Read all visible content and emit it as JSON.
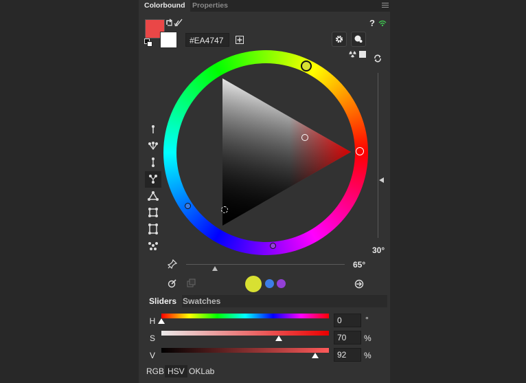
{
  "tabs": [
    {
      "label": "Colorbound",
      "active": true
    },
    {
      "label": "Properties",
      "active": false
    }
  ],
  "header": {
    "help_label": "?",
    "foreground_color": "#EA4747",
    "background_color": "#FFFFFF",
    "hex_value": "#EA4747",
    "add_label": "+"
  },
  "wheel": {
    "rotation_label": "30°",
    "spread_label": "65°",
    "spread_fraction": 0.18,
    "vertical_slider_fraction": 0.35
  },
  "harmony_swatches": [
    "#D8E032",
    "#3D7EE6",
    "#9340D6"
  ],
  "section_tabs": [
    {
      "label": "Sliders",
      "active": true
    },
    {
      "label": "Swatches",
      "active": false
    }
  ],
  "sliders": [
    {
      "label": "H",
      "value": "0",
      "unit": "°",
      "fraction": 0.0
    },
    {
      "label": "S",
      "value": "70",
      "unit": "%",
      "fraction": 0.7
    },
    {
      "label": "V",
      "value": "92",
      "unit": "%",
      "fraction": 0.92
    }
  ],
  "modes": [
    {
      "label": "RGB",
      "active": false
    },
    {
      "label": "HSV",
      "active": true
    },
    {
      "label": "OKLab",
      "active": false
    }
  ],
  "icons": {
    "swap": "swap-icon",
    "reset": "reset-colors-icon",
    "wifi": "wifi-icon",
    "settings": "gear-icon",
    "picker": "color-dots-icon",
    "refresh": "refresh-icon",
    "pin": "pin-icon"
  }
}
